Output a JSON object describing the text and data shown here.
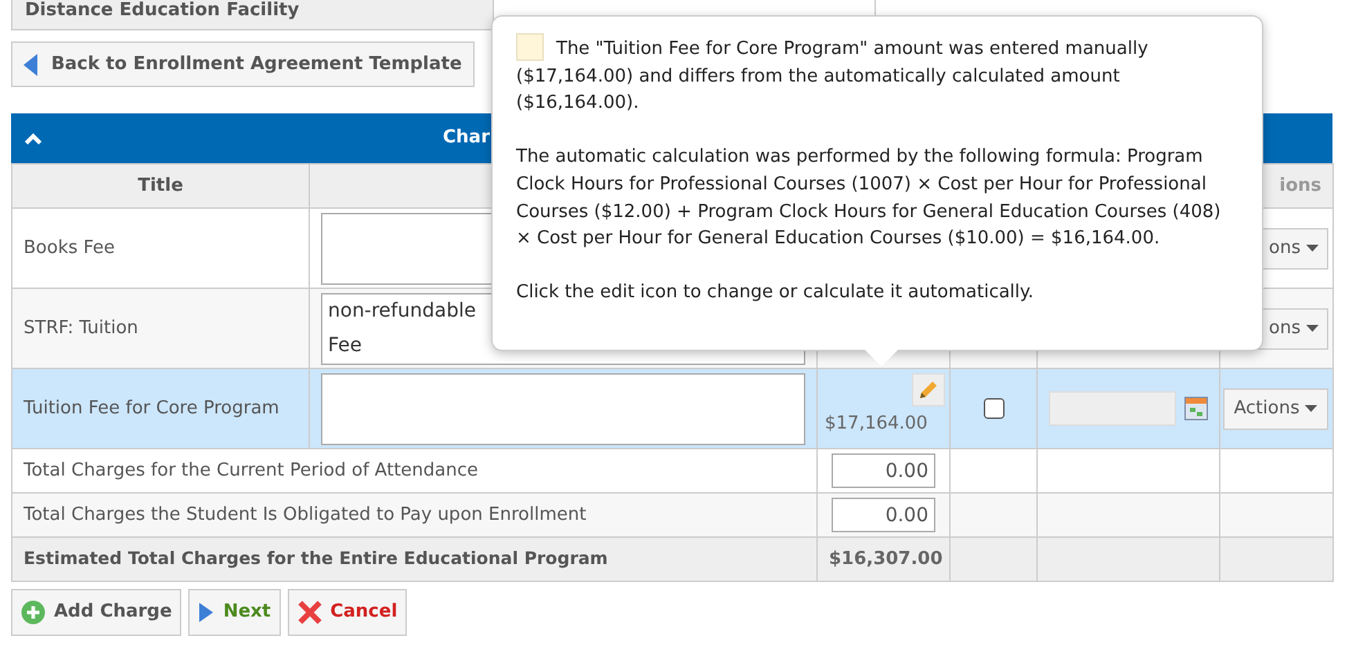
{
  "facility_label": "Distance Education Facility",
  "back_button": "Back to Enrollment Agreement Template",
  "section": {
    "title": "Char",
    "expanded": true
  },
  "columns": [
    "Title",
    "ions"
  ],
  "rows": [
    {
      "kind": "charge",
      "title": "Books Fee",
      "description_lines": [],
      "actions": "ons",
      "selected": false
    },
    {
      "kind": "charge",
      "title": "STRF: Tuition",
      "description_lines": [
        "non-refundable",
        "Fee"
      ],
      "actions": "ons",
      "selected": false
    },
    {
      "kind": "charge",
      "title": "Tuition Fee for Core Program",
      "description_lines": [],
      "amount": "$17,164.00",
      "checked": false,
      "actions": "Actions",
      "selected": true
    },
    {
      "kind": "total_input",
      "title": "Total Charges for the Current Period of Attendance",
      "amount": "0.00"
    },
    {
      "kind": "total_input",
      "title": "Total Charges the Student Is Obligated to Pay upon Enrollment",
      "amount": "0.00"
    },
    {
      "kind": "grand_total",
      "title": "Estimated Total Charges for the Entire Educational Program",
      "amount": "$16,307.00"
    }
  ],
  "buttons": [
    {
      "kind": "add",
      "label": "Add Charge"
    },
    {
      "kind": "next",
      "label": "Next"
    },
    {
      "kind": "cancel",
      "label": "Cancel"
    }
  ],
  "tooltip": {
    "paragraphs": [
      "The \"Tuition Fee for Core Program\" amount was entered manually ($17,164.00) and differs from the automatically calculated amount ($16,164.00).",
      "The automatic calculation was performed by the following formula: Program Clock Hours for Professional Courses (1007) × Cost per Hour for Professional Courses ($12.00) + Program Clock Hours for General Education Courses (408) × Cost per Hour for General Education Courses ($10.00) = $16,164.00.",
      "Click the edit icon to change or calculate it automatically."
    ]
  }
}
